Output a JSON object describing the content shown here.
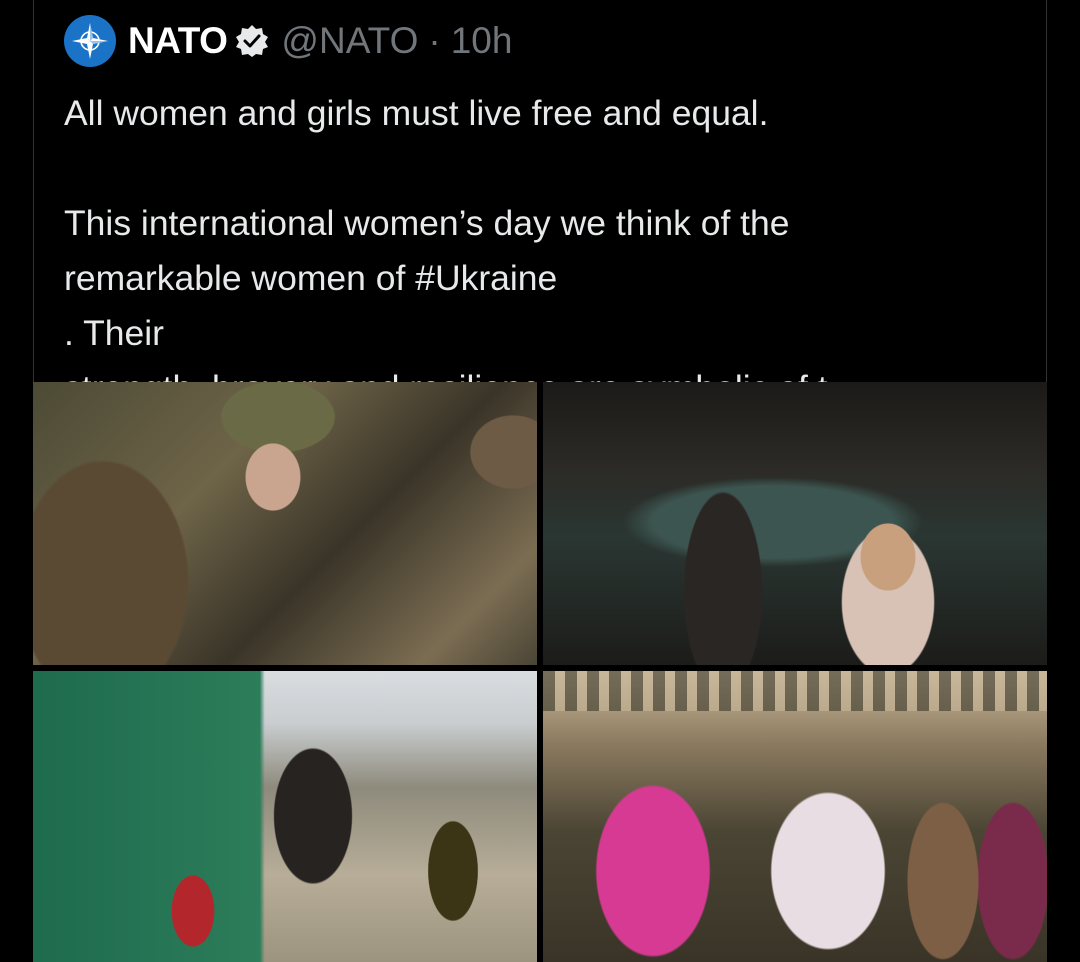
{
  "tweet": {
    "author_name": "NATO",
    "handle": "@NATO",
    "separator": "·",
    "time": "10h",
    "text_line1": "All women and girls must live free and equal.",
    "text_line2": "This international women’s day we think of the",
    "text_line3_before": "remarkable women of ",
    "hashtag": "#Ukraine",
    "text_line3_after": ". Their",
    "text_line4": "strength, bravery and resilience are symbolic of t..."
  },
  "icons": {
    "avatar": "nato-compass-rose-icon",
    "verified": "verified-badge-icon",
    "flag": "ukraine-flag-icon"
  },
  "colors": {
    "background": "#000000",
    "text": "#e7e9ea",
    "secondary_text": "#71767b",
    "nato_blue": "#1b73c8",
    "flag_blue": "#1e63c7",
    "flag_yellow": "#f6c61a"
  },
  "media": {
    "count": 4
  }
}
